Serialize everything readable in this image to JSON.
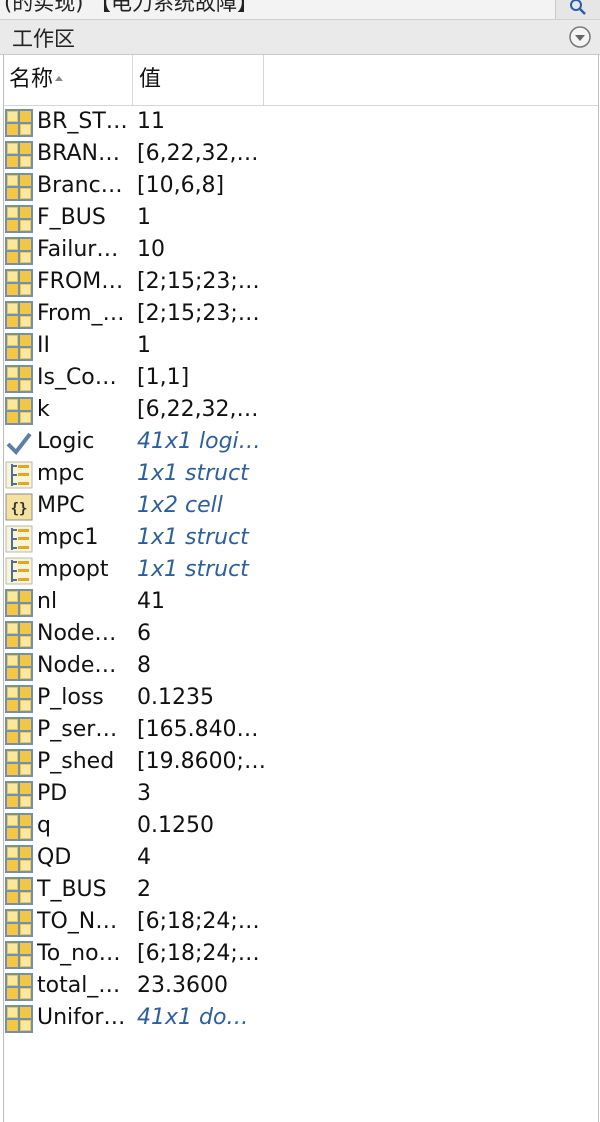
{
  "top_strip": {
    "text": "(的实现) 【电力系统故障】"
  },
  "panel": {
    "title": "工作区"
  },
  "columns": {
    "name": "名称",
    "value": "值"
  },
  "colors": {
    "header_bg": "#eaeaea",
    "italic_value": "#2b5f9e",
    "icon_matrix": "#f3c742",
    "icon_matrix_border": "#6f8fb5"
  },
  "rows": [
    {
      "name": "BR_ST…",
      "value": "11",
      "icon": "matrix-icon",
      "italic": false
    },
    {
      "name": "BRAN…",
      "value": "[6,22,32,…",
      "icon": "matrix-icon",
      "italic": false
    },
    {
      "name": "Branc…",
      "value": "[10,6,8]",
      "icon": "matrix-icon",
      "italic": false
    },
    {
      "name": "F_BUS",
      "value": "1",
      "icon": "matrix-icon",
      "italic": false
    },
    {
      "name": "Failur…",
      "value": "10",
      "icon": "matrix-icon",
      "italic": false
    },
    {
      "name": "FROM…",
      "value": "[2;15;23;…",
      "icon": "matrix-icon",
      "italic": false
    },
    {
      "name": "From_…",
      "value": "[2;15;23;…",
      "icon": "matrix-icon",
      "italic": false
    },
    {
      "name": "II",
      "value": "1",
      "icon": "matrix-icon",
      "italic": false
    },
    {
      "name": "Is_Co…",
      "value": "[1,1]",
      "icon": "matrix-icon",
      "italic": false
    },
    {
      "name": "k",
      "value": "[6,22,32,…",
      "icon": "matrix-icon",
      "italic": false
    },
    {
      "name": "Logic",
      "value": "41x1 logi…",
      "icon": "logical-check-icon",
      "italic": true
    },
    {
      "name": "mpc",
      "value": "1x1 struct",
      "icon": "struct-icon",
      "italic": true
    },
    {
      "name": "MPC",
      "value": "1x2 cell",
      "icon": "cell-braces-icon",
      "italic": true
    },
    {
      "name": "mpc1",
      "value": "1x1 struct",
      "icon": "struct-icon",
      "italic": true
    },
    {
      "name": "mpopt",
      "value": "1x1 struct",
      "icon": "struct-icon",
      "italic": true
    },
    {
      "name": "nl",
      "value": "41",
      "icon": "matrix-icon",
      "italic": false
    },
    {
      "name": "Node…",
      "value": "6",
      "icon": "matrix-icon",
      "italic": false
    },
    {
      "name": "Node…",
      "value": "8",
      "icon": "matrix-icon",
      "italic": false
    },
    {
      "name": "P_loss",
      "value": "0.1235",
      "icon": "matrix-icon",
      "italic": false
    },
    {
      "name": "P_ser…",
      "value": "[165.840…",
      "icon": "matrix-icon",
      "italic": false
    },
    {
      "name": "P_shed",
      "value": "[19.8600;…",
      "icon": "matrix-icon",
      "italic": false
    },
    {
      "name": "PD",
      "value": "3",
      "icon": "matrix-icon",
      "italic": false
    },
    {
      "name": "q",
      "value": "0.1250",
      "icon": "matrix-icon",
      "italic": false
    },
    {
      "name": "QD",
      "value": "4",
      "icon": "matrix-icon",
      "italic": false
    },
    {
      "name": "T_BUS",
      "value": "2",
      "icon": "matrix-icon",
      "italic": false
    },
    {
      "name": "TO_N…",
      "value": "[6;18;24;…",
      "icon": "matrix-icon",
      "italic": false
    },
    {
      "name": "To_no…",
      "value": "[6;18;24;…",
      "icon": "matrix-icon",
      "italic": false
    },
    {
      "name": "total_…",
      "value": "23.3600",
      "icon": "matrix-icon",
      "italic": false
    },
    {
      "name": "Unifor…",
      "value": "41x1 do…",
      "icon": "matrix-icon",
      "italic": true
    }
  ]
}
